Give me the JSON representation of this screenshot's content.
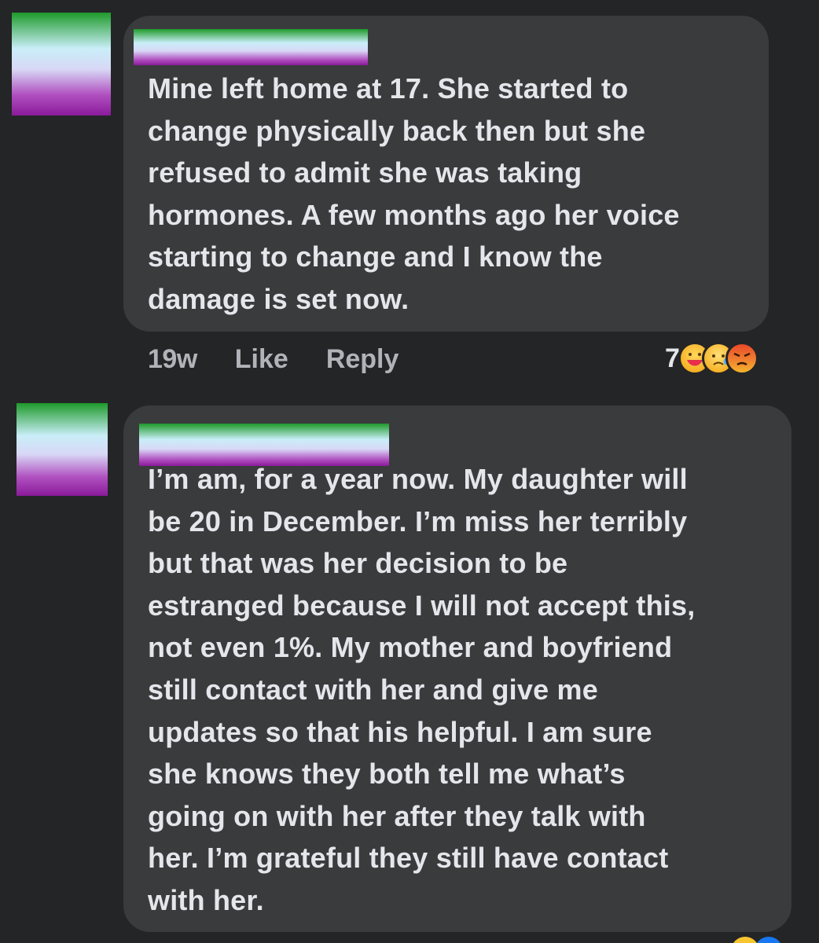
{
  "comments": [
    {
      "text": "Mine left home at 17. She started to\nchange physically back then but she\nrefused to admit she was taking\nhormones. A few months ago her voice\nstarting to change and I know the\ndamage is set now.",
      "time": "19w",
      "like_label": "Like",
      "reply_label": "Reply",
      "reaction_count": "7",
      "reactions": [
        "care-emoji-icon",
        "sad-emoji-icon",
        "angry-emoji-icon"
      ]
    },
    {
      "text": "I’m am, for a year now. My daughter will\nbe 20 in December. I’m miss her terribly\nbut that was her decision to be\nestranged because I will not accept this,\nnot even 1%. My mother and boyfriend\nstill contact with her and give me\nupdates so that his helpful. I am sure\nshe knows they both tell me what’s\ngoing on with her after they talk with\nher. I’m grateful they still have contact\nwith her."
    }
  ],
  "colors": {
    "background": "#242526",
    "bubble": "#3a3b3c",
    "text": "#e4e6eb",
    "secondary_text": "#b0b3b8"
  }
}
